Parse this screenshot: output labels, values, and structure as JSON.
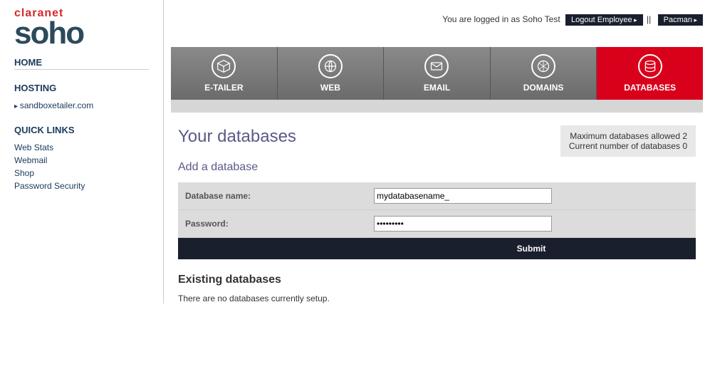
{
  "logo": {
    "top": "claranet",
    "bottom": "soho"
  },
  "topbar": {
    "logged_in_prefix": "You are logged in as ",
    "username": "Soho Test",
    "logout_label": "Logout Employee",
    "separator": "||",
    "app_label": "Pacman"
  },
  "sidebar": {
    "home": "HOME",
    "hosting_heading": "HOSTING",
    "hosting_domain": "sandboxetailer.com",
    "quicklinks_heading": "QUICK LINKS",
    "links": {
      "webstats": "Web Stats",
      "webmail": "Webmail",
      "shop": "Shop",
      "password_security": "Password Security"
    }
  },
  "tabs": {
    "etailer": "E-TAILER",
    "web": "WEB",
    "email": "EMAIL",
    "domains": "DOMAINS",
    "databases": "DATABASES"
  },
  "page": {
    "title": "Your databases",
    "info_max": "Maximum databases allowed 2",
    "info_current": "Current number of databases 0",
    "add_heading": "Add a database",
    "db_name_label": "Database name:",
    "db_name_value": "mydatabasename_",
    "password_label": "Password:",
    "password_value": "•••••••••",
    "submit_label": "Submit",
    "existing_heading": "Existing databases",
    "existing_msg": "There are no databases currently setup."
  }
}
